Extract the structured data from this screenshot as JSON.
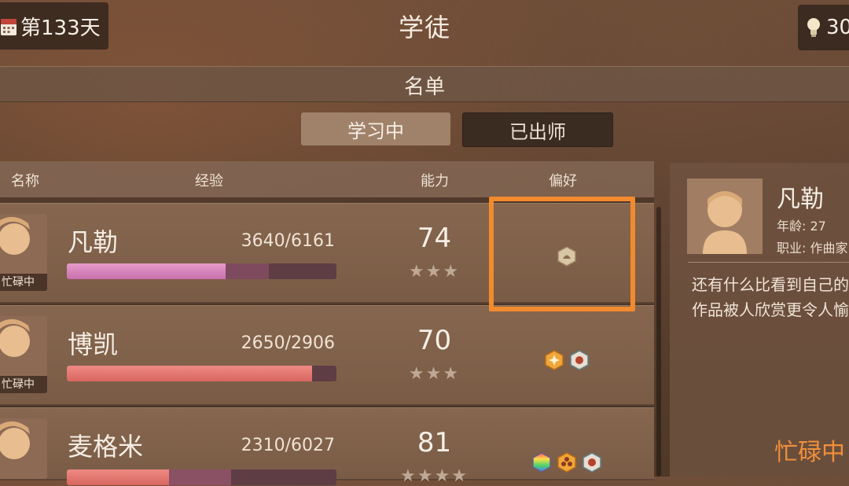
{
  "top_bar": {
    "day_label": "第133天",
    "page_title": "学徒",
    "resource_value": "30",
    "calendar_icon": "calendar-icon",
    "resource_icon": "lightbulb-icon"
  },
  "list": {
    "title": "名单",
    "tabs": [
      {
        "label": "学习中",
        "active": true
      },
      {
        "label": "已出师",
        "active": false
      }
    ],
    "columns": {
      "name": "名称",
      "exp": "经验",
      "ability": "能力",
      "preference": "偏好"
    }
  },
  "apprentices": [
    {
      "name": "凡勒",
      "status": "忙碌中",
      "exp": "3640/6161",
      "exp_fraction": 0.59,
      "ability": "74",
      "stars": "★★★",
      "preference_icons": [
        "leaf-hex-icon"
      ]
    },
    {
      "name": "博凯",
      "status": "忙碌中",
      "exp": "2650/2906",
      "exp_fraction": 0.91,
      "ability": "70",
      "stars": "★★★",
      "preference_icons": [
        "sparkle-hex-icon",
        "red-dot-hex-icon"
      ]
    },
    {
      "name": "麦格米",
      "status": "",
      "exp": "2310/6027",
      "exp_fraction": 0.38,
      "ability": "81",
      "stars": "★★★★",
      "preference_icons": [
        "rainbow-hex-icon",
        "flower-hex-icon",
        "red-dot-hex-icon"
      ]
    }
  ],
  "detail": {
    "name": "凡勒",
    "age": "年龄: 27",
    "job": "职业: 作曲家",
    "quote": "还有什么比看到自己的作品被人欣赏更令人愉快?",
    "status": "忙碌中"
  },
  "colors": {
    "accent_orange": "#f28a2e",
    "bar_pink": "#d27fb4",
    "bar_red": "#e0716a",
    "status_orange": "#f08f3a"
  }
}
